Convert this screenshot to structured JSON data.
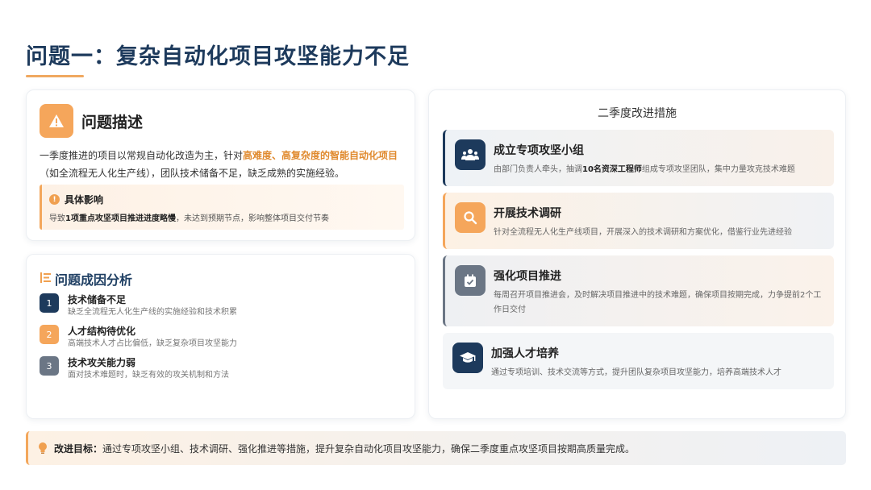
{
  "title": "问题一：复杂自动化项目攻坚能力不足",
  "problem": {
    "icon": "warning-icon",
    "title": "问题描述",
    "desc_part1": "一季度推进的项目以常规自动化改造为主，针对",
    "desc_highlight": "高难度、高复杂度的智能自动化项目",
    "desc_part2": "（如全流程无人化生产线），团队技术储备不足，缺乏成熟的实施经验。",
    "impact": {
      "title": "具体影响",
      "text_prefix": "导致",
      "text_bold": "1项重点攻坚项目推进进度略慢",
      "text_suffix": "，未达到预期节点，影响整体项目交付节奏"
    }
  },
  "causes": {
    "title": "问题成因分析",
    "items": [
      {
        "num": "1",
        "name": "技术储备不足",
        "sub": "缺乏全流程无人化生产线的实施经验和技术积累",
        "color": "#1d3a5c"
      },
      {
        "num": "2",
        "name": "人才结构待优化",
        "sub": "高端技术人才占比偏低，缺乏复杂项目攻坚能力",
        "color": "#f5a65b"
      },
      {
        "num": "3",
        "name": "技术攻关能力弱",
        "sub": "面对技术难题时，缺乏有效的攻关机制和方法",
        "color": "#6b7685"
      }
    ]
  },
  "measures": {
    "title": "二季度改进措施",
    "items": [
      {
        "title": "成立专项攻坚小组",
        "desc_prefix": "由部门负责人牵头，抽调",
        "desc_bold": "10名资深工程师",
        "desc_suffix": "组成专项攻坚团队，集中力量攻克技术难题",
        "icon": "team-icon",
        "color": "#1d3a5c"
      },
      {
        "title": "开展技术调研",
        "desc_prefix": "针对全流程无人化生产线项目，开展深入的技术调研和方案优化，借鉴行业先进经验",
        "desc_bold": "",
        "desc_suffix": "",
        "icon": "search-icon",
        "color": "#f5a65b"
      },
      {
        "title": "强化项目推进",
        "desc_prefix": "每周召开项目推进会，及时解决项目推进中的技术难题，确保项目按期完成，力争提前2个工作日交付",
        "desc_bold": "",
        "desc_suffix": "",
        "icon": "calendar-check-icon",
        "color": "#6b7685"
      },
      {
        "title": "加强人才培养",
        "desc_prefix": "通过专项培训、技术交流等方式，提升团队复杂项目攻坚能力，培养高端技术人才",
        "desc_bold": "",
        "desc_suffix": "",
        "icon": "graduation-cap-icon",
        "color": "#1d3a5c"
      }
    ]
  },
  "goal": {
    "label": "改进目标：",
    "text": "通过专项攻坚小组、技术调研、强化推进等措施，提升复杂自动化项目攻坚能力，确保二季度重点攻坚项目按期高质量完成。"
  },
  "colors": {
    "navy": "#1d3a5c",
    "orange": "#f5a65b",
    "gray": "#6b7685"
  }
}
